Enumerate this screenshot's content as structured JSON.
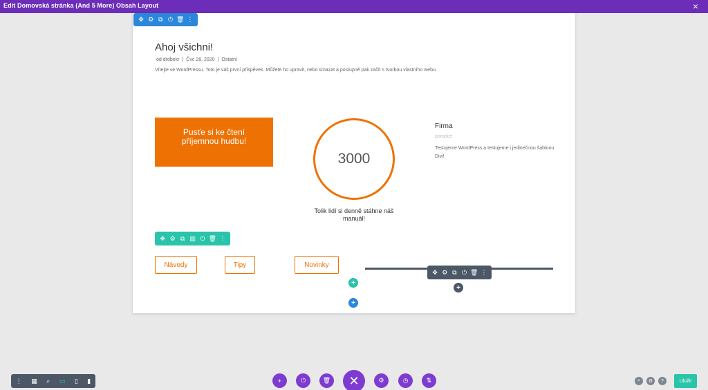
{
  "topbar": {
    "title": "Edit Domovská stránka (And 5 More) Obsah Layout",
    "close_icon": "×"
  },
  "section_toolbar": {
    "icons": [
      "✥",
      "⚙",
      "⧉",
      "⏻",
      "🗑",
      "⋮"
    ]
  },
  "post": {
    "title": "Ahoj všichni!",
    "meta_author": "od drobekr",
    "meta_date": "Čvc 28, 2020",
    "meta_category": "Ostatní",
    "meta_sep": "|",
    "text": "Vítejte ve WordPressu. Toto je váš první příspěvek. Můžete ho upravit, nebo smazat a postupně pak začít s tvorbou vlastního webu."
  },
  "cta": {
    "text": "Pusťe si ke čtení příjemnou hudbu!"
  },
  "counter": {
    "value": "3000",
    "caption": "Tolik lidí si denně stáhne náš manuál!"
  },
  "firma": {
    "name": "Firma",
    "subtitle": "poradce",
    "text": "Testujeme WordPress a testujeme i jedinečnou šablonu Divi!"
  },
  "row_toolbar": {
    "icons": [
      "✥",
      "⚙",
      "⧉",
      "▥",
      "⏻",
      "🗑",
      "⋮"
    ]
  },
  "module_toolbar": {
    "icons": [
      "✥",
      "⚙",
      "⧉",
      "⏻",
      "🗑",
      "⋮"
    ]
  },
  "buttons": {
    "navody": "Návody",
    "tipy": "Tipy",
    "novinky": "Novinky"
  },
  "plus": "+",
  "bottom_left": {
    "icons": [
      "⋮",
      "▦",
      "⌕",
      "▭",
      "▯",
      "▮"
    ]
  },
  "bottom_center": {
    "add": "+",
    "power": "⏻",
    "trash": "🗑",
    "close": "✕",
    "settings": "⚙",
    "history": "◷",
    "sort": "⇅"
  },
  "bottom_right": {
    "search": "⌕",
    "portability": "⚙",
    "help": "?",
    "save": "Uložit"
  },
  "colors": {
    "purple": "#6c2eb9",
    "orange": "#ee7203",
    "teal": "#29c4a9",
    "blue": "#2b87da",
    "dark": "#4c5866"
  }
}
